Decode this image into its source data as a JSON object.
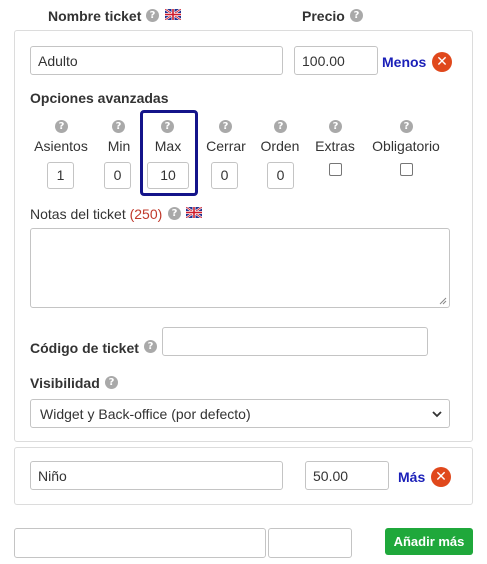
{
  "header": {
    "ticket_name_label": "Nombre ticket",
    "price_label": "Precio"
  },
  "tickets": [
    {
      "name": "Adulto",
      "price": "100.00",
      "toggle_label": "Menos"
    },
    {
      "name": "Niño",
      "price": "50.00",
      "toggle_label": "Más"
    }
  ],
  "advanced": {
    "title": "Opciones avanzadas",
    "columns": [
      {
        "label": "Asientos",
        "value": "1"
      },
      {
        "label": "Min",
        "value": "0"
      },
      {
        "label": "Max",
        "value": "10"
      },
      {
        "label": "Cerrar",
        "value": "0"
      },
      {
        "label": "Orden",
        "value": "0"
      },
      {
        "label": "Extras",
        "checked": false
      },
      {
        "label": "Obligatorio",
        "checked": false
      }
    ],
    "notes_label": "Notas del ticket",
    "notes_count": "(250)",
    "notes_value": "",
    "code_label": "Código de ticket",
    "code_value": "",
    "visibility_label": "Visibilidad",
    "visibility_selected": "Widget y Back-office (por defecto)"
  },
  "footer": {
    "add_more_label": "Añadir más",
    "new_name_value": "",
    "new_price_value": ""
  },
  "icons": {
    "help": "question-circle-icon",
    "flag": "uk-flag-icon",
    "remove": "close-circle-icon",
    "dropdown": "chevron-down-icon"
  },
  "colors": {
    "link_blue": "#1a1fb8",
    "remove_orange": "#e0481c",
    "button_green": "#1fa83b",
    "highlight_navy": "#14148a",
    "notes_count_red": "#c0392b"
  }
}
